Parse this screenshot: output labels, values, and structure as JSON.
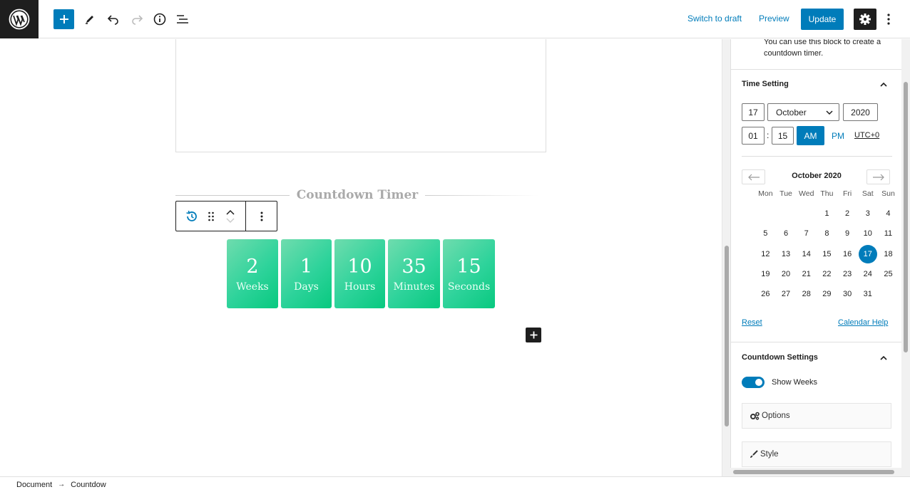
{
  "header": {
    "switch_to_draft": "Switch to draft",
    "preview": "Preview",
    "update": "Update"
  },
  "canvas": {
    "block_title": "Countdown Timer",
    "timer": [
      {
        "value": "2",
        "label": "Weeks"
      },
      {
        "value": "1",
        "label": "Days"
      },
      {
        "value": "10",
        "label": "Hours"
      },
      {
        "value": "35",
        "label": "Minutes"
      },
      {
        "value": "15",
        "label": "Seconds"
      }
    ],
    "accent_color": "#2ed39b"
  },
  "sidebar": {
    "block_description": "You can use this block to create a countdown timer.",
    "time_setting": {
      "title": "Time Setting",
      "day": "17",
      "month": "October",
      "year": "2020",
      "hour": "01",
      "minute": "15",
      "am": "AM",
      "pm": "PM",
      "timezone": "UTC+0",
      "calendar": {
        "month_label": "October 2020",
        "weekdays": [
          "Mon",
          "Tue",
          "Wed",
          "Thu",
          "Fri",
          "Sat",
          "Sun"
        ],
        "weeks": [
          [
            "",
            "",
            "",
            "1",
            "2",
            "3",
            "4"
          ],
          [
            "5",
            "6",
            "7",
            "8",
            "9",
            "10",
            "11"
          ],
          [
            "12",
            "13",
            "14",
            "15",
            "16",
            "17",
            "18"
          ],
          [
            "19",
            "20",
            "21",
            "22",
            "23",
            "24",
            "25"
          ],
          [
            "26",
            "27",
            "28",
            "29",
            "30",
            "31",
            ""
          ]
        ],
        "selected_day": "17"
      },
      "reset": "Reset",
      "calendar_help": "Calendar Help"
    },
    "countdown_settings": {
      "title": "Countdown Settings",
      "show_weeks_label": "Show Weeks",
      "show_weeks": true,
      "options_label": "Options",
      "style_label": "Style"
    }
  },
  "footer": {
    "breadcrumb": [
      "Document",
      "Countdow"
    ]
  },
  "colors": {
    "primary": "#007cba",
    "dark": "#1e1e1e"
  }
}
